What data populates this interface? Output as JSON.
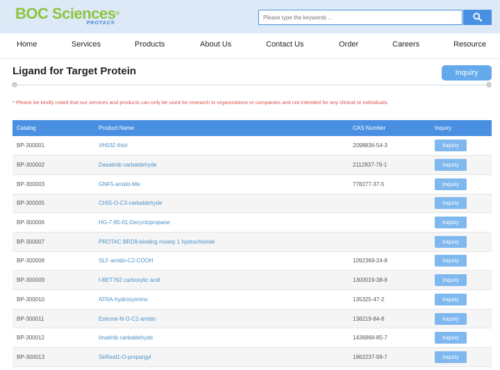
{
  "brand": {
    "name": "BOC Sciences",
    "reg": "®",
    "sub": "PROTAC®"
  },
  "search": {
    "placeholder": "Please type the keywords ..."
  },
  "nav": [
    "Home",
    "Services",
    "Products",
    "About Us",
    "Contact Us",
    "Order",
    "Careers",
    "Resource"
  ],
  "page": {
    "title": "Ligand for Target Protein",
    "inquiry_label": "Inquiry",
    "notice": "* Please be kindly noted that our services and products can only be used for research to organizations or companies and not intended for any clinical or individuals."
  },
  "table": {
    "headers": [
      "Catalog",
      "Product Name",
      "CAS Number",
      "Inquiry"
    ],
    "rows": [
      {
        "catalog": "BP-300001",
        "name": "VH032 thiol",
        "cas": "2098836-54-3",
        "inquiry": "Inquiry"
      },
      {
        "catalog": "BP-300002",
        "name": "Dasatinib carbaldehyde",
        "cas": "2112837-79-1",
        "inquiry": "Inquiry"
      },
      {
        "catalog": "BP-300003",
        "name": "GNF5-amido-Me",
        "cas": "778277-37-5",
        "inquiry": "Inquiry"
      },
      {
        "catalog": "BP-300005",
        "name": "Ch55-O-C3-carbaldehyde",
        "cas": "",
        "inquiry": "Inquiry"
      },
      {
        "catalog": "BP-300006",
        "name": "HG-7-85-01-Decyclopropane",
        "cas": "",
        "inquiry": "Inquiry"
      },
      {
        "catalog": "BP-300007",
        "name": "PROTAC BRD9-binding moiety 1 hydrochloride",
        "cas": "",
        "inquiry": "Inquiry"
      },
      {
        "catalog": "BP-300008",
        "name": "SLF-amido-C2-COOH",
        "cas": "1092369-24-8",
        "inquiry": "Inquiry"
      },
      {
        "catalog": "BP-300009",
        "name": "I-BET762 carboxylic acid",
        "cas": "1300019-38-8",
        "inquiry": "Inquiry"
      },
      {
        "catalog": "BP-300010",
        "name": "ATRA-hydroxyimino",
        "cas": "135325-47-2",
        "inquiry": "Inquiry"
      },
      {
        "catalog": "BP-300011",
        "name": "Estrone-N-O-C1-amido",
        "cas": "138219-84-8",
        "inquiry": "Inquiry"
      },
      {
        "catalog": "BP-300012",
        "name": "Imatinib carbaldehyde",
        "cas": "1436868-85-7",
        "inquiry": "Inquiry"
      },
      {
        "catalog": "BP-300013",
        "name": "SirReal1-O-propargyl",
        "cas": "1862237-99-7",
        "inquiry": "Inquiry"
      }
    ]
  },
  "colors": {
    "accent": "#4a90e2",
    "brand_green": "#8cc43f",
    "notice_red": "#d9534f",
    "header_bg": "#dde9f7"
  }
}
